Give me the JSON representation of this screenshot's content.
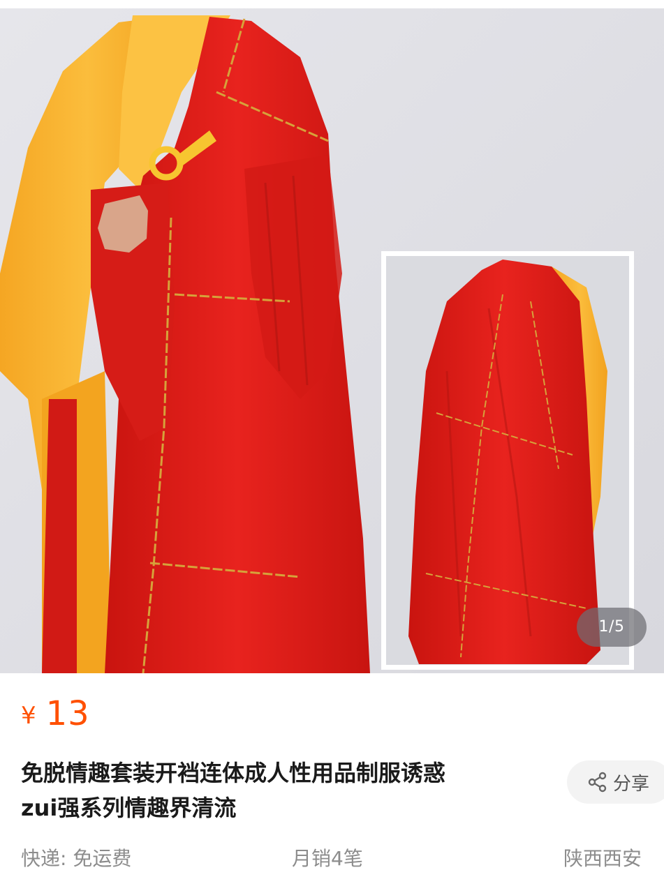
{
  "gallery": {
    "counter": "1/5",
    "colors": {
      "backdrop": "#dfe0e6",
      "robe_red": "#e0201d",
      "robe_yellow": "#f7b733"
    }
  },
  "product": {
    "price": {
      "currency": "¥",
      "value": "13"
    },
    "title_line1": "免脱情趣套装开裆连体成人性用品制服诱惑",
    "title_line2": "zui强系列情趣界清流",
    "share_label": "分享",
    "shipping": "快递: 免运费",
    "monthly_sales": "月销4笔",
    "location": "陕西西安"
  },
  "colors": {
    "price": "#ff5000",
    "meta_text": "#8c8c8c",
    "title_text": "#1a1a1a"
  }
}
